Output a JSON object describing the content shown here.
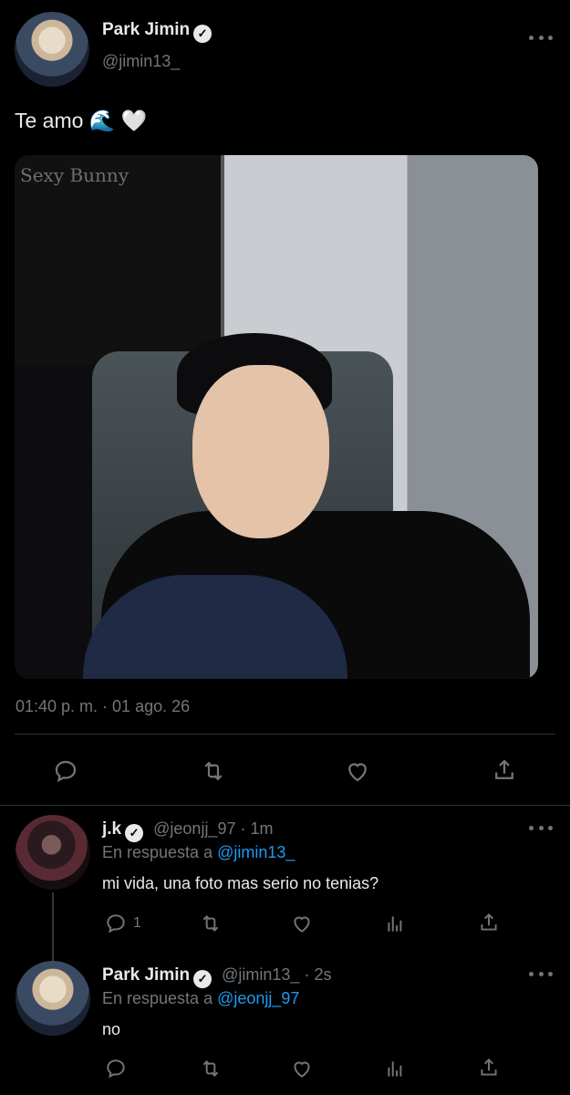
{
  "main_tweet": {
    "author_name": "Park Jimin",
    "handle": "@jimin13_",
    "text": "Te amo 🌊 🤍",
    "image_caption": "Sexy Bunny",
    "timestamp": "01:40 p. m. · 01 ago. 26"
  },
  "replies": [
    {
      "author_name": "j.k",
      "handle": "@jeonjj_97",
      "time": "· 1m",
      "replying_to_label": "En respuesta a",
      "replying_to_handle": "@jimin13_",
      "text": "mi vida, una foto mas serio no tenias?",
      "reply_count": "1"
    },
    {
      "author_name": "Park Jimin",
      "handle": "@jimin13_",
      "time": "· 2s",
      "replying_to_label": "En respuesta a",
      "replying_to_handle": "@jeonjj_97",
      "text": "no",
      "reply_count": ""
    }
  ],
  "icons": [
    "verified-icon",
    "more-icon",
    "reply-icon",
    "retweet-icon",
    "like-icon",
    "share-icon",
    "analytics-icon"
  ],
  "colors": {
    "background": "#000000",
    "text": "#e7e9ea",
    "muted": "#71767b",
    "link": "#1d9bf0"
  }
}
